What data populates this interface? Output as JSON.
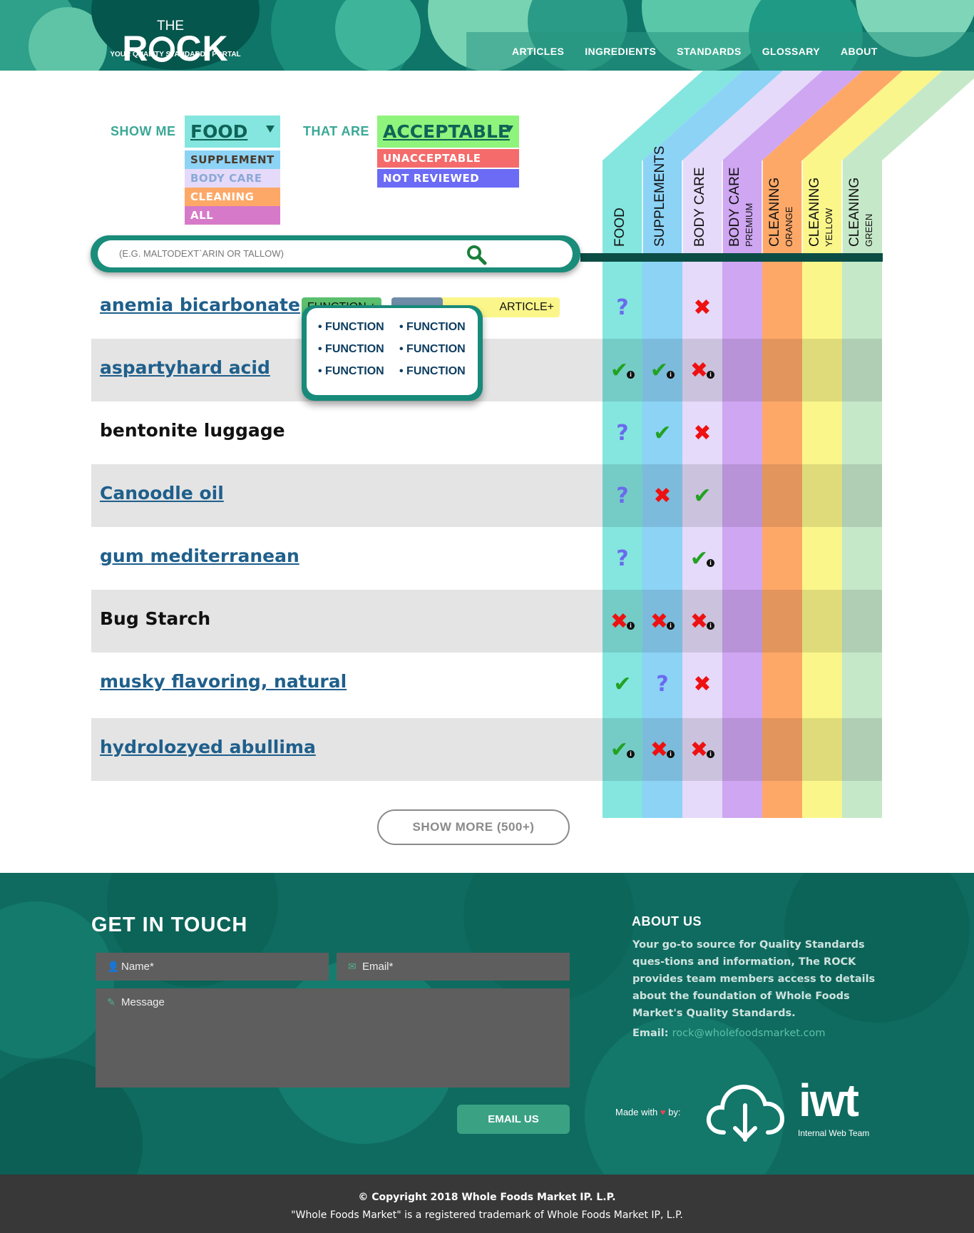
{
  "header": {
    "logo_the": "THE",
    "logo_rock_pre": "R",
    "logo_rock_post": "CK",
    "tagline": "YOUR QUALITY STANDARDS PORTAL",
    "nav": [
      "ARTICLES",
      "INGREDIENTS",
      "STANDARDS",
      "GLOSSARY",
      "ABOUT"
    ]
  },
  "filter": {
    "show_me_label": "SHOW ME",
    "that_are_label": "THAT ARE",
    "category_selected": "FOOD",
    "category_options": [
      "SUPPLEMENT",
      "BODY CARE",
      "CLEANING",
      "ALL"
    ],
    "status_selected": "ACCEPTABLE",
    "status_options": [
      "UNACCEPTABLE",
      "NOT REVIEWED"
    ]
  },
  "search": {
    "placeholder": "(E.G. MALTODEXT`ARIN OR TALLOW)",
    "icon": "search-icon"
  },
  "columns": [
    {
      "label": "FOOD",
      "sub": "",
      "color": "#84e6df"
    },
    {
      "label": "SUPPLEMENTS",
      "sub": "",
      "color": "#8cd3f6"
    },
    {
      "label": "BODY CARE",
      "sub": "",
      "color": "#e5daf9"
    },
    {
      "label": "BODY CARE",
      "sub": "PREMIUM",
      "color": "#cfa6f2"
    },
    {
      "label": "CLEANING",
      "sub": "ORANGE",
      "color": "#fea868"
    },
    {
      "label": "CLEANING",
      "sub": "YELLOW",
      "color": "#fbf68a"
    },
    {
      "label": "CLEANING",
      "sub": "GREEN",
      "color": "#c5e8c9"
    }
  ],
  "tags": {
    "function": "FUNCTION +",
    "article": "ARTICLE+",
    "popup_items": [
      "• FUNCTION",
      "• FUNCTION",
      "• FUNCTION",
      "• FUNCTION",
      "• FUNCTION",
      "• FUNCTION"
    ]
  },
  "ingredients": [
    {
      "name": "anemia bicarbonate",
      "link": true,
      "marks": [
        "q",
        "",
        "x"
      ]
    },
    {
      "name": "aspartyhard acid",
      "link": true,
      "marks": [
        "ci",
        "ci",
        "xi"
      ]
    },
    {
      "name": "bentonite luggage",
      "link": false,
      "marks": [
        "q",
        "c",
        "x"
      ]
    },
    {
      "name": "Canoodle oil",
      "link": true,
      "marks": [
        "q",
        "x",
        "c"
      ]
    },
    {
      "name": "gum mediterranean",
      "link": true,
      "marks": [
        "q",
        "",
        "ci"
      ]
    },
    {
      "name": "Bug Starch",
      "link": false,
      "marks": [
        "xi",
        "xi",
        "xi"
      ]
    },
    {
      "name": "musky flavoring, natural",
      "link": true,
      "marks": [
        "c",
        "q",
        "x"
      ]
    },
    {
      "name": "hydrolozyed abullima",
      "link": true,
      "marks": [
        "ci",
        "xi",
        "xi"
      ]
    }
  ],
  "show_more": "SHOW MORE (500+)",
  "footer": {
    "get_in_touch": "GET IN TOUCH",
    "name_placeholder": "Name*",
    "email_placeholder": "Email*",
    "message_placeholder": "Message",
    "email_button": "EMAIL US",
    "about_heading": "ABOUT US",
    "about_text": "Your go-to source for Quality Standards ques-tions and information, The ROCK provides team members access to details about the foundation of Whole Foods Market's Quality Standards.",
    "email_label": "Email:",
    "email_address": "rock@wholefoodsmarket.com",
    "made_with": "Made with",
    "by": "by:",
    "iwt": "iwt",
    "iwt_sub": "Internal Web Team"
  },
  "copyright": {
    "line1": "© Copyright 2018 Whole Foods Market IP. L.P.",
    "line2": "\"Whole Foods Market\" is a registered trademark of Whole Foods Market IP, L.P."
  }
}
